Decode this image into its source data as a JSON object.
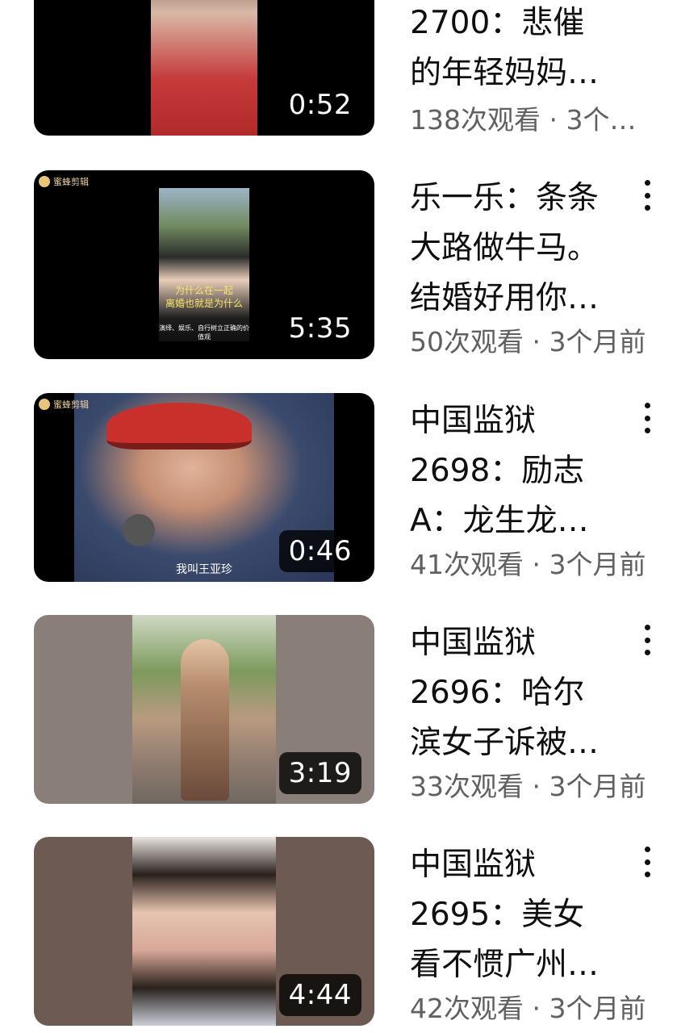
{
  "videos": [
    {
      "title_lines": [
        "2700：悲催",
        "的年轻妈妈…"
      ],
      "meta": "138次观看 · 3个…",
      "duration": "0:52"
    },
    {
      "title_lines": [
        "乐一乐：条条",
        "大路做牛马。",
        "结婚好用你…"
      ],
      "meta": "50次观看 · 3个月前",
      "duration": "5:35",
      "watermark": "蜜蜂剪辑",
      "caption_top": "为什么在一起",
      "caption_mid": "离婚也就是为什么",
      "caption_bottom": "演绎、娱乐、自行树立正确的价值观"
    },
    {
      "title_lines": [
        "中国监狱",
        "2698：励志",
        "A：龙生龙…"
      ],
      "meta": "41次观看 · 3个月前",
      "duration": "0:46",
      "watermark": "蜜蜂剪辑",
      "caption": "我叫王亚珍"
    },
    {
      "title_lines": [
        "中国监狱",
        "2696：哈尔",
        "滨女子诉被…"
      ],
      "meta": "33次观看 · 3个月前",
      "duration": "3:19"
    },
    {
      "title_lines": [
        "中国监狱",
        "2695：美女",
        "看不惯广州…"
      ],
      "meta": "42次观看 · 3个月前",
      "duration": "4:44"
    }
  ],
  "colors": {
    "text": "#0f0f0f",
    "meta": "#606060",
    "duration_bg": "#000000"
  },
  "icons": {
    "more": "more-vert-icon"
  }
}
